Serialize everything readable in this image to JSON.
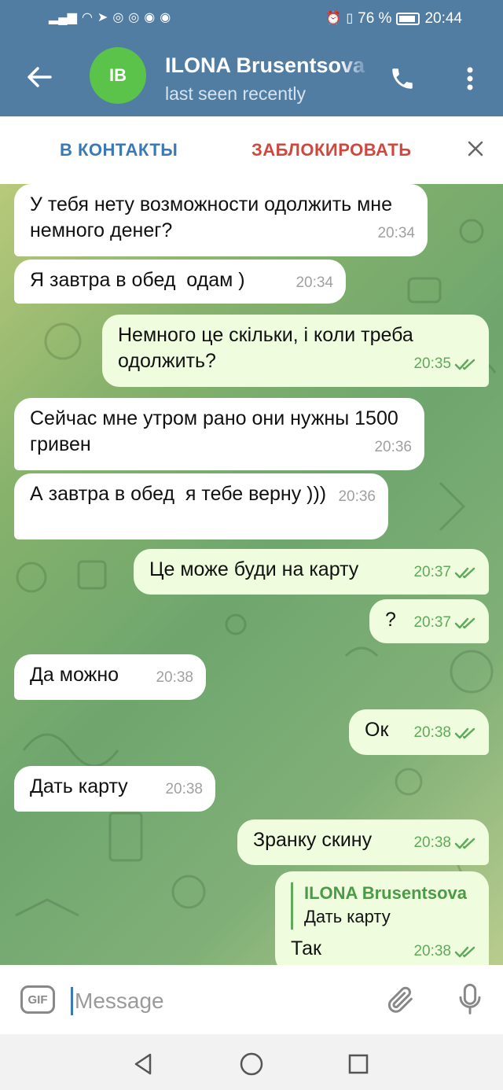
{
  "status_bar": {
    "battery": "76 %",
    "time": "20:44"
  },
  "header": {
    "avatar_initials": "IB",
    "name": "ILONA Brusentsova",
    "status": "last seen recently"
  },
  "action_bar": {
    "add_contact": "В КОНТАКТЫ",
    "block": "ЗАБЛОКИРОВАТЬ"
  },
  "messages": [
    {
      "dir": "in",
      "text": "У тебя нету возможности одолжить мне немного денег?",
      "time": "20:34"
    },
    {
      "dir": "in",
      "text": "Я завтра в обед  одам )",
      "time": "20:34"
    },
    {
      "dir": "out",
      "text": "Немного це скільки, і коли треба одолжить?",
      "time": "20:35",
      "read": true
    },
    {
      "dir": "in",
      "text": "Сейчас мне утром рано они нужны 1500 гривен",
      "time": "20:36"
    },
    {
      "dir": "in",
      "text": "А завтра в обед  я тебе верну )))",
      "time": "20:36"
    },
    {
      "dir": "out",
      "text": "Це може буди на карту",
      "time": "20:37",
      "read": true
    },
    {
      "dir": "out",
      "text": "?",
      "time": "20:37",
      "read": true
    },
    {
      "dir": "in",
      "text": "Да можно",
      "time": "20:38"
    },
    {
      "dir": "out",
      "text": "Ок",
      "time": "20:38",
      "read": true
    },
    {
      "dir": "in",
      "text": "Дать карту",
      "time": "20:38"
    },
    {
      "dir": "out",
      "text": "Зранку скину",
      "time": "20:38",
      "read": true
    },
    {
      "dir": "out",
      "text": "Так",
      "time": "20:38",
      "read": true,
      "reply_name": "ILONA Brusentsova",
      "reply_text": "Дать карту"
    }
  ],
  "composer": {
    "gif_label": "GIF",
    "placeholder": "Message"
  },
  "colors": {
    "header_bg": "#527da3",
    "incoming_bubble": "#ffffff",
    "outgoing_bubble": "#effdde",
    "check_green": "#5eaa5a",
    "block_red": "#d0473e",
    "add_blue": "#3a79b6"
  },
  "icons": {
    "back": "arrow-left-icon",
    "call": "phone-icon",
    "more": "more-vertical-icon",
    "close": "close-icon",
    "attach": "paperclip-icon",
    "mic": "microphone-icon",
    "read": "double-check-icon",
    "nav_back": "triangle-back-icon",
    "nav_home": "circle-home-icon",
    "nav_recents": "square-recents-icon"
  }
}
